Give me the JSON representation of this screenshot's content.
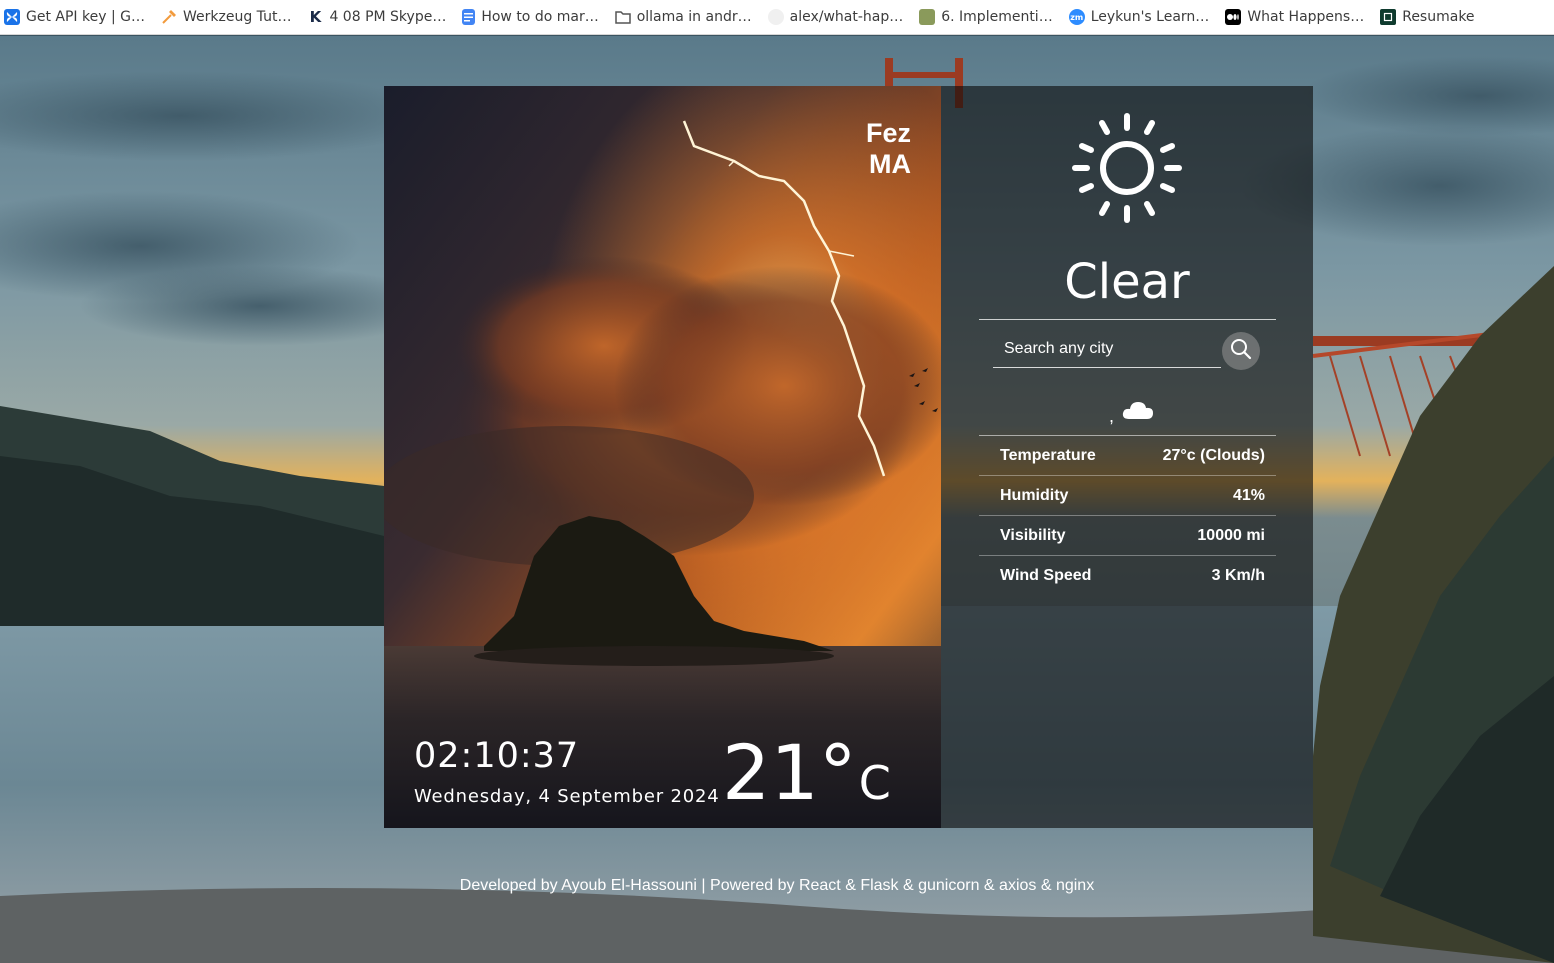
{
  "bookmarks": [
    {
      "label": "Get API key | G…",
      "icon": "butterfly-icon",
      "color": "#1a73e8"
    },
    {
      "label": "Werkzeug Tut…",
      "icon": "hammer-icon",
      "color": "#f29b3d"
    },
    {
      "label": "4 08 PM Skype…",
      "icon": "kaggle-k-icon",
      "color": "#1b2b48"
    },
    {
      "label": "How to do mar…",
      "icon": "google-docs-icon",
      "color": "#4285f4"
    },
    {
      "label": "ollama in andr…",
      "icon": "folder-icon",
      "color": "#555555"
    },
    {
      "label": "alex/what-hap…",
      "icon": "github-icon",
      "color": "#dddddd"
    },
    {
      "label": "6. Implementi…",
      "icon": "course-icon",
      "color": "#8a9a5b"
    },
    {
      "label": "Leykun's Learn…",
      "icon": "zoom-icon",
      "color": "#2d8cff"
    },
    {
      "label": "What Happens…",
      "icon": "medium-icon",
      "color": "#000000"
    },
    {
      "label": "Resumake",
      "icon": "resumake-icon",
      "color": "#0f3b2e"
    }
  ],
  "left_card": {
    "city": "Fez",
    "country": "MA",
    "time": "02:10:37",
    "date": "Wednesday, 4 September 2024",
    "temperature": "21",
    "degree_symbol": "°",
    "unit": "C"
  },
  "right_card": {
    "icon": "sun-icon",
    "condition": "Clear",
    "search_placeholder": "Search any city",
    "search_result_prefix": ",",
    "result_icon": "cloud-icon",
    "details": [
      {
        "label": "Temperature",
        "value": "27°c (Clouds)"
      },
      {
        "label": "Humidity",
        "value": "41%"
      },
      {
        "label": "Visibility",
        "value": "10000 mi"
      },
      {
        "label": "Wind Speed",
        "value": "3 Km/h"
      }
    ]
  },
  "footer": "Developed by Ayoub El-Hassouni | Powered by React & Flask & gunicorn & axios & nginx",
  "colors": {
    "panel_bg": "rgba(12,12,12,0.62)",
    "text": "#ffffff",
    "storm_orange": "#e07a2a"
  }
}
